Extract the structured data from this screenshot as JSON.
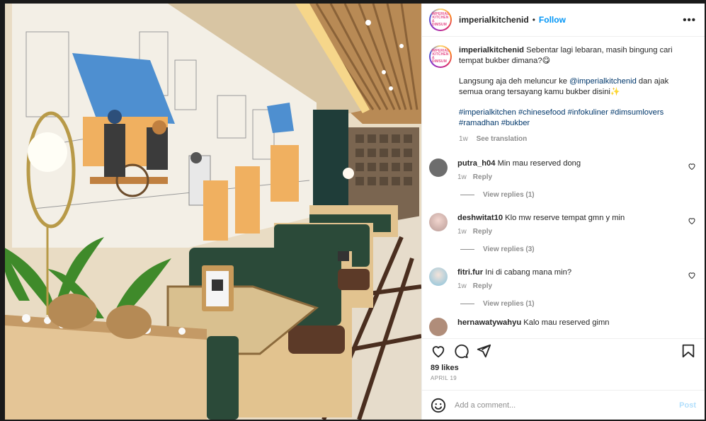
{
  "post": {
    "author": "imperialkitchenid",
    "follow_label": "Follow",
    "more_icon": "more-horizontal-icon",
    "avatar_text": [
      "IMPERIAL",
      "KITCHEN",
      "& DIMSUM"
    ]
  },
  "caption": {
    "username": "imperialkitchenid",
    "line1": "Sebentar lagi lebaran, masih bingung cari tempat bukber dimana?😋",
    "line2_prefix": "Langsung aja deh meluncur ke ",
    "mention": "@imperialkitchenid",
    "line2_suffix": " dan ajak semua orang tersayang kamu bukber disini✨",
    "hashtags_line1": "#imperialkitchen #chinesefood #infokuliner #dimsumlovers",
    "hashtags_line2": "#ramadhan #bukber",
    "time": "1w",
    "see_translation": "See translation"
  },
  "comments": [
    {
      "username": "putra_h04",
      "text": "Min mau reserved dong",
      "time": "1w",
      "reply_label": "Reply",
      "view_replies": "View replies (1)",
      "avatar_color": "#6d6d6d"
    },
    {
      "username": "deshwitat10",
      "text": "Klo mw reserve tempat gmn y min",
      "time": "1w",
      "reply_label": "Reply",
      "view_replies": "View replies (3)",
      "avatar_color": "#c9a9a6"
    },
    {
      "username": "fitri.fur",
      "text": "Ini di cabang mana min?",
      "time": "1w",
      "reply_label": "Reply",
      "view_replies": "View replies (1)",
      "avatar_color": "#9ccbe0"
    },
    {
      "username": "hernawatywahyu",
      "text": "Kalo mau reserved gimn",
      "time": "",
      "reply_label": "",
      "view_replies": "",
      "avatar_color": "#b08d7a"
    }
  ],
  "likes": "89 likes",
  "date": "APRIL 19",
  "add_comment": {
    "placeholder": "Add a comment...",
    "post_label": "Post"
  },
  "colors": {
    "link": "#00376b",
    "follow": "#0095f6",
    "muted": "#8e8e8e",
    "post_disabled": "#b2dffc"
  },
  "icons": [
    "heart-icon",
    "comment-icon",
    "share-icon",
    "bookmark-icon",
    "emoji-icon"
  ]
}
